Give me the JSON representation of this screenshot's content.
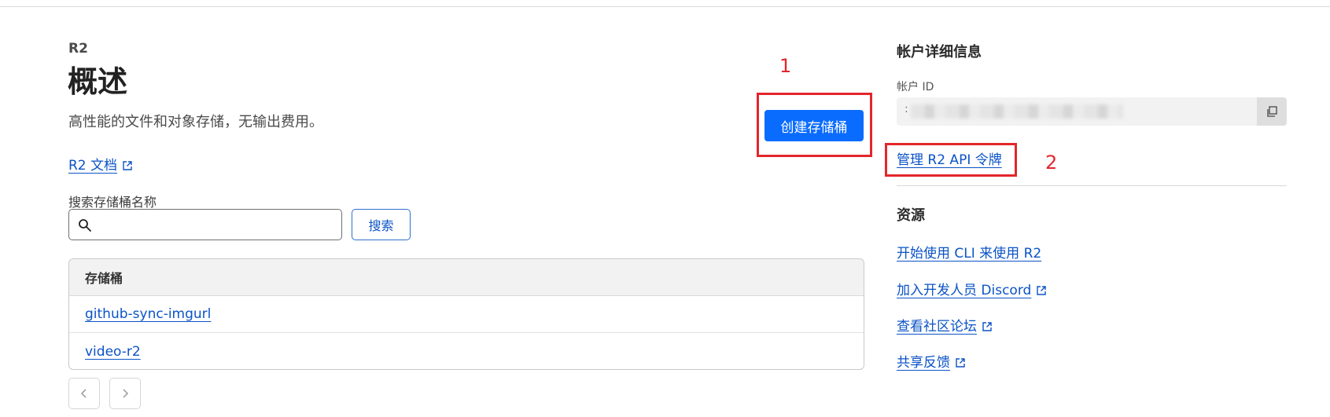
{
  "header": {
    "eyebrow": "R2",
    "title": "概述",
    "subtitle": "高性能的文件和对象存储，无输出费用。"
  },
  "docs_link": {
    "label": "R2 文档",
    "icon": "external-link-icon"
  },
  "search": {
    "label": "搜索存储桶名称",
    "value": "",
    "placeholder": "",
    "button_label": "搜索",
    "icon": "search-icon"
  },
  "buckets_table": {
    "header": "存储桶",
    "rows": [
      "github-sync-imgurl",
      "video-r2"
    ]
  },
  "pagination": {
    "prev_icon": "chevron-left-icon",
    "next_icon": "chevron-right-icon"
  },
  "create_button": {
    "label": "创建存储桶"
  },
  "annotations": {
    "one": "1",
    "two": "2",
    "color": "#e3262b"
  },
  "account": {
    "title": "帐户详细信息",
    "id_label": "帐户 ID",
    "id_prefix": ":",
    "copy_icon": "copy-icon",
    "manage_tokens_label": "管理 R2 API 令牌"
  },
  "resources": {
    "title": "资源",
    "links": [
      {
        "label": "开始使用 CLI 来使用 R2",
        "external": false
      },
      {
        "label": "加入开发人员 Discord",
        "external": true
      },
      {
        "label": "查看社区论坛",
        "external": true
      },
      {
        "label": "共享反馈",
        "external": true
      }
    ]
  },
  "colors": {
    "accent": "#0a6cff",
    "link": "#0b53c7",
    "annotation_red": "#e3262b"
  }
}
